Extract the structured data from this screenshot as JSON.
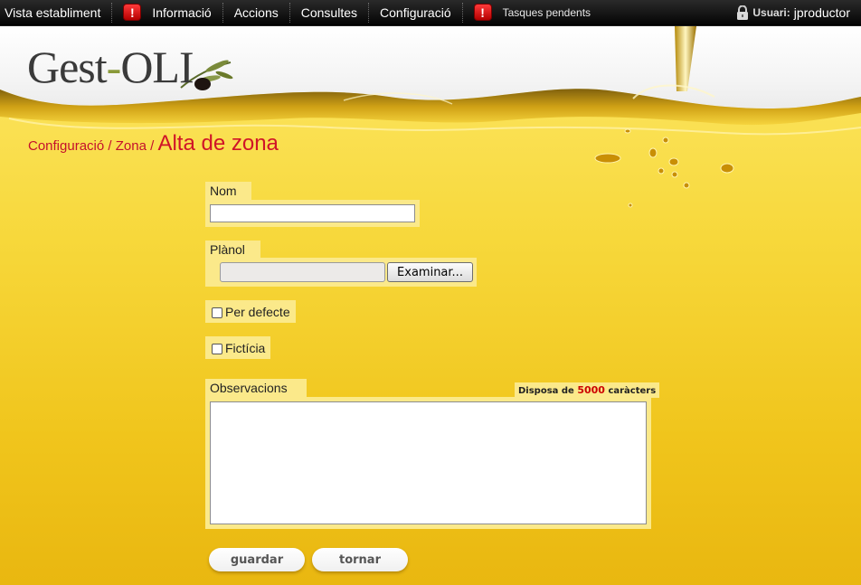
{
  "nav": {
    "items": [
      {
        "label": "Vista establiment",
        "alert": false
      },
      {
        "label": "Informació",
        "alert": true
      },
      {
        "label": "Accions",
        "alert": false
      },
      {
        "label": "Consultes",
        "alert": false
      },
      {
        "label": "Configuració",
        "alert": false
      },
      {
        "label": "Tasques pendents",
        "alert": true
      }
    ],
    "alert_symbol": "!",
    "user_label": "Usuari:",
    "user_name": "jproductor"
  },
  "logo": {
    "part1": "Gest",
    "dash": "-",
    "part2": "OLI"
  },
  "breadcrumb": {
    "item1": "Configuració",
    "sep": " / ",
    "item2": "Zona",
    "current": "Alta de zona"
  },
  "form": {
    "nom_label": "Nom",
    "nom_value": "",
    "planol_label": "Plànol",
    "browse_label": "Examinar...",
    "default_label": "Per defecte",
    "ficticia_label": "Fictícia",
    "obs_label": "Observacions",
    "counter_prefix": "Disposa de",
    "counter_value": "5000",
    "counter_suffix": "caràcters",
    "obs_value": ""
  },
  "buttons": {
    "save": "guardar",
    "back": "tornar"
  },
  "colors": {
    "accent": "#c4102c",
    "oil": "#f2c81e",
    "field_bg": "#fbe98a"
  },
  "icons": {
    "alert": "alert-icon",
    "lock": "lock-icon"
  }
}
